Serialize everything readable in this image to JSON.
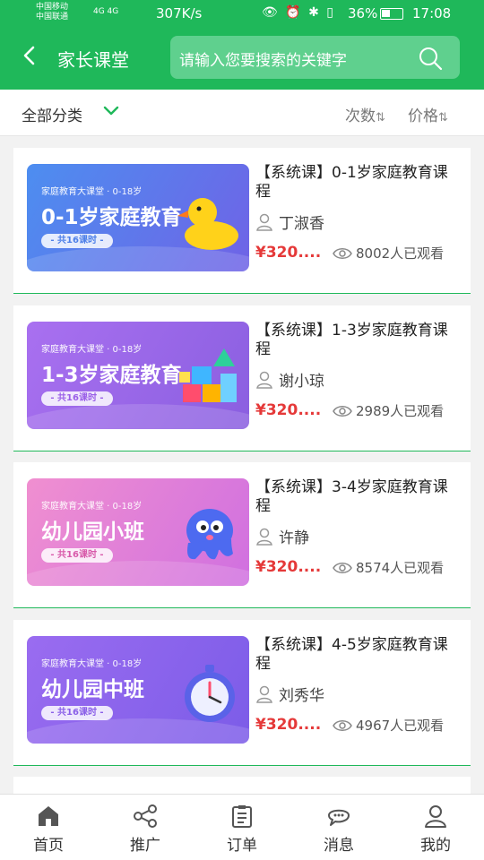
{
  "status_bar": {
    "carrier1": "中国移动",
    "carrier2": "中国联通",
    "network": "4G 4G",
    "speed": "307K/s",
    "battery": "36%",
    "time": "17:08"
  },
  "header": {
    "title": "家长课堂",
    "search_placeholder": "请输入您要搜索的关键字",
    "bg_color": "#1fb85a"
  },
  "filter": {
    "category_label": "全部分类",
    "sort_count_label": "次数",
    "sort_price_label": "价格"
  },
  "courses": [
    {
      "thumb_small": "家庭教育大课堂 · 0-18岁",
      "thumb_big": "0-1岁家庭教育",
      "thumb_pill": "- 共16课时 -",
      "title": "【系统课】0-1岁家庭教育课程",
      "author": "丁淑香",
      "price": "¥320....",
      "views": "8002人已观看",
      "art": "duck"
    },
    {
      "thumb_small": "家庭教育大课堂 · 0-18岁",
      "thumb_big": "1-3岁家庭教育",
      "thumb_pill": "- 共16课时 -",
      "title": "【系统课】1-3岁家庭教育课程",
      "author": "谢小琼",
      "price": "¥320....",
      "views": "2989人已观看",
      "art": "blocks"
    },
    {
      "thumb_small": "家庭教育大课堂 · 0-18岁",
      "thumb_big": "幼儿园小班",
      "thumb_pill": "- 共16课时 -",
      "title": "【系统课】3-4岁家庭教育课程",
      "author": "许静",
      "price": "¥320....",
      "views": "8574人已观看",
      "art": "octopus"
    },
    {
      "thumb_small": "家庭教育大课堂 · 0-18岁",
      "thumb_big": "幼儿园中班",
      "thumb_pill": "- 共16课时 -",
      "title": "【系统课】4-5岁家庭教育课程",
      "author": "刘秀华",
      "price": "¥320....",
      "views": "4967人已观看",
      "art": "stopwatch"
    }
  ],
  "tabbar": {
    "items": [
      {
        "label": "首页",
        "icon": "home-icon"
      },
      {
        "label": "推广",
        "icon": "share-icon"
      },
      {
        "label": "订单",
        "icon": "order-icon"
      },
      {
        "label": "消息",
        "icon": "message-icon"
      },
      {
        "label": "我的",
        "icon": "user-icon"
      }
    ]
  }
}
